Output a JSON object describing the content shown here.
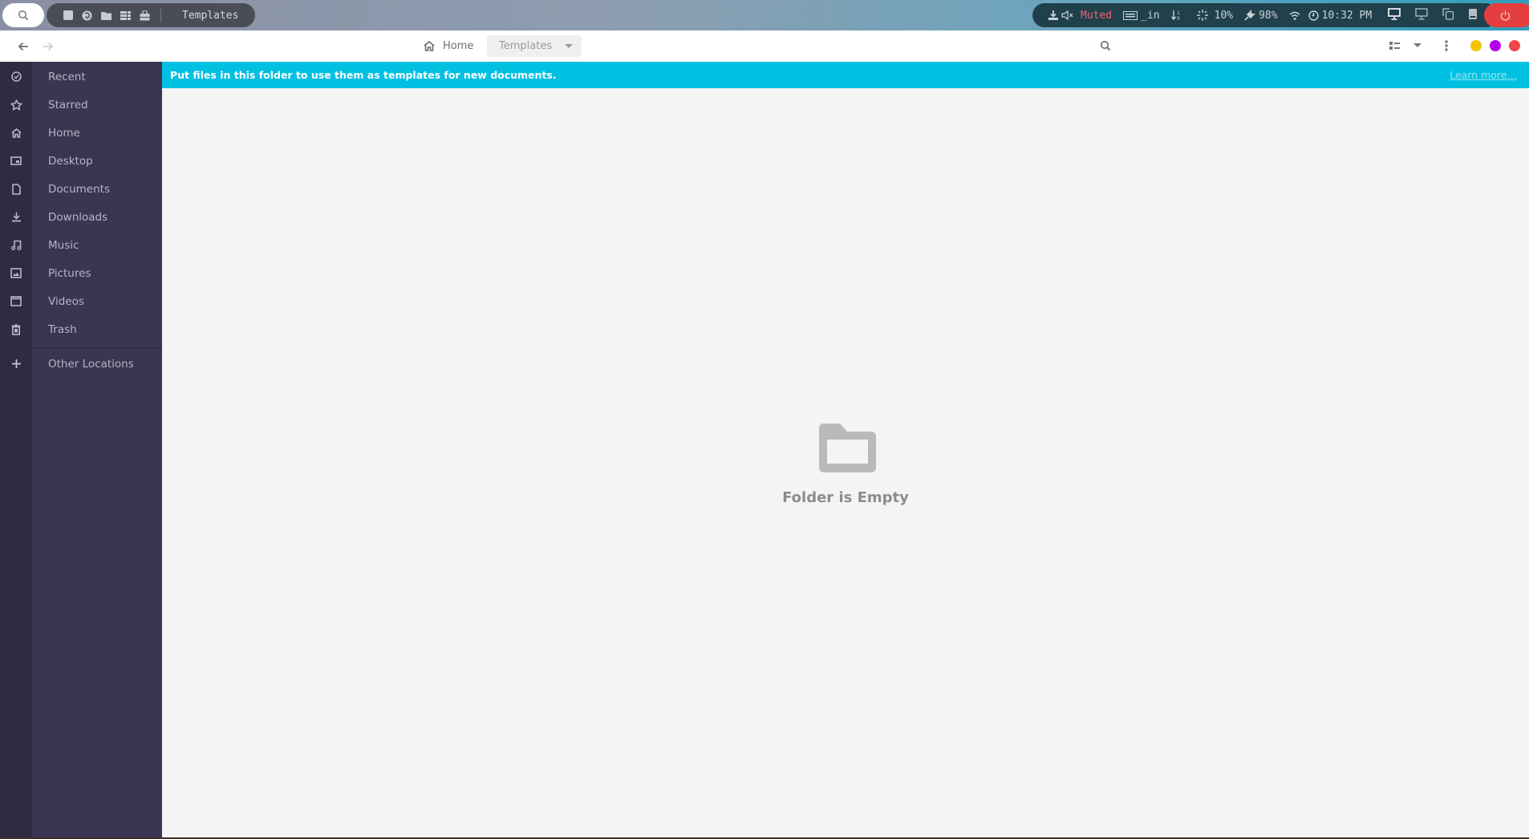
{
  "top_panel": {
    "search_icon": "search-icon",
    "dock_icons": [
      "square-app-icon",
      "firefox-icon",
      "folder-icon",
      "files-list-icon",
      "store-bag-icon"
    ],
    "active_window_title": "Templates",
    "tray": {
      "download_icon": "download-icon",
      "volume_icon": "volume-muted-icon",
      "volume_status": "Muted",
      "keyboard_layout": "_in",
      "sort_indicator": "1 9",
      "cpu_icon": "spinner-icon",
      "cpu_usage": "10%",
      "battery_icon": "plug-icon",
      "battery": "98%",
      "wifi_icon": "wifi-icon",
      "clock_icon": "clock-icon",
      "time": "10:32 PM",
      "workspace_icons": [
        "monitor-active-icon",
        "monitor-icon",
        "copy-windows-icon",
        "phone-icon"
      ],
      "power_icon": "power-icon"
    },
    "colors": {
      "muted": "#f2636f",
      "power": "#e53e3e"
    }
  },
  "header": {
    "back_icon": "arrow-left-icon",
    "forward_icon": "arrow-right-icon",
    "breadcrumb": {
      "home_label": "Home",
      "current_label": "Templates"
    },
    "search_icon": "search-icon",
    "view_icon": "list-view-icon",
    "view_dropdown_icon": "chevron-down-icon",
    "menu_icon": "kebab-menu-icon",
    "window_controls": [
      {
        "name": "minimize",
        "color": "#f5c400"
      },
      {
        "name": "maximize",
        "color": "#b400e8"
      },
      {
        "name": "close",
        "color": "#f2444b"
      }
    ]
  },
  "sidebar": {
    "items": [
      {
        "label": "Recent",
        "icon": "clock-icon"
      },
      {
        "label": "Starred",
        "icon": "star-icon"
      },
      {
        "label": "Home",
        "icon": "home-icon"
      },
      {
        "label": "Desktop",
        "icon": "desktop-icon"
      },
      {
        "label": "Documents",
        "icon": "document-icon"
      },
      {
        "label": "Downloads",
        "icon": "download-icon"
      },
      {
        "label": "Music",
        "icon": "music-icon"
      },
      {
        "label": "Pictures",
        "icon": "picture-icon"
      },
      {
        "label": "Videos",
        "icon": "video-icon"
      },
      {
        "label": "Trash",
        "icon": "trash-icon"
      }
    ],
    "other": {
      "label": "Other Locations",
      "icon": "plus-icon"
    }
  },
  "infobar": {
    "message": "Put files in this folder to use them as templates for new documents.",
    "link": "Learn more…",
    "color": "#00c0e2"
  },
  "main": {
    "empty_icon": "folder-icon",
    "empty_text": "Folder is Empty"
  }
}
